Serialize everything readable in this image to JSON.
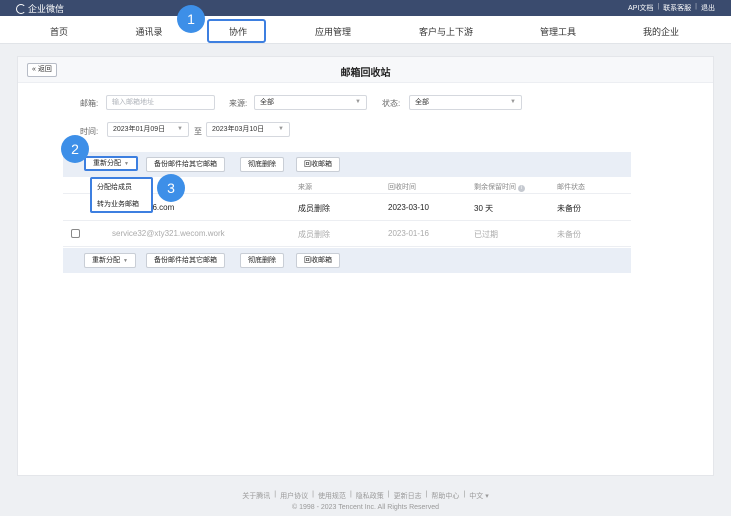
{
  "topbar": {
    "brand": "企业微信",
    "links": [
      "API文档",
      "联系客服",
      "退出"
    ]
  },
  "nav": {
    "items": [
      "首页",
      "通讯录",
      "协作",
      "应用管理",
      "客户与上下游",
      "管理工具",
      "我的企业"
    ],
    "active": "协作"
  },
  "page": {
    "back_label": "« 返回",
    "title": "邮箱回收站"
  },
  "filters": {
    "email_label": "邮箱:",
    "email_placeholder": "输入邮箱地址",
    "source_label": "来源:",
    "source_value": "全部",
    "status_label": "状态:",
    "status_value": "全部",
    "time_label": "时间:",
    "date_from": "2023年01月09日",
    "date_to_label": "至",
    "date_to": "2023年03月10日"
  },
  "toolbar": {
    "reassign": "重新分配",
    "backup": "备份邮件给其它邮箱",
    "delete": "彻底删除",
    "recycle": "回收邮箱"
  },
  "dropdown": {
    "options": [
      "分配给成员",
      "转为业务邮箱"
    ]
  },
  "table": {
    "headers": [
      "来源",
      "回收时间",
      "剩余保留时间",
      "邮件状态"
    ],
    "rows": [
      {
        "email": "56.com",
        "source": "成员删除",
        "time": "2023-03-10",
        "remaining": "30 天",
        "status": "未备份"
      },
      {
        "email": "service32@xty321.wecom.work",
        "source": "成员删除",
        "time": "2023-01-16",
        "remaining": "已过期",
        "status": "未备份"
      }
    ]
  },
  "badges": [
    "1",
    "2",
    "3"
  ],
  "footer": {
    "links": [
      "关于腾讯",
      "用户协议",
      "使用规范",
      "隐私政策",
      "更新日志",
      "帮助中心",
      "中文 ▾"
    ],
    "copyright": "© 1998 - 2023 Tencent Inc. All Rights Reserved"
  },
  "colors": {
    "topbar": "#3a4b6e",
    "highlight": "#3d7fe0",
    "badge": "#3d8fe8",
    "toolbar_bg": "#e9eef6"
  }
}
